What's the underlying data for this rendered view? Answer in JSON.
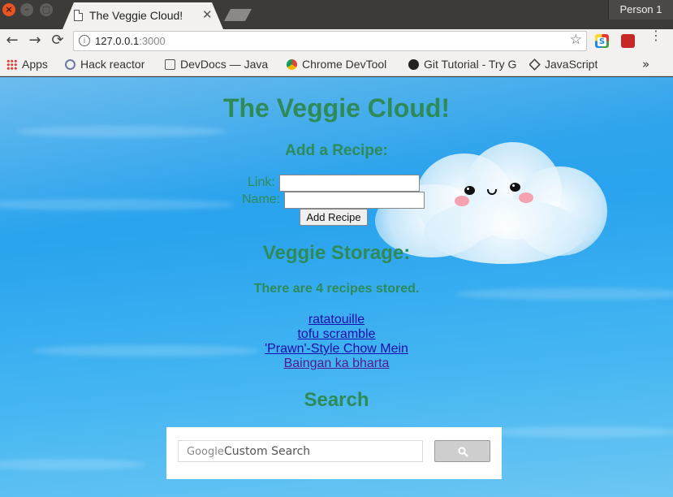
{
  "browser": {
    "tab_title": "The Veggie Cloud!",
    "tab_close": "✕",
    "profile": "Person 1",
    "window_buttons": {
      "close": "×",
      "minimize": "–",
      "maximize": "▢"
    }
  },
  "toolbar": {
    "back": "←",
    "forward": "→",
    "reload": "⟳",
    "info": "i",
    "url_host": "127.0.0.1",
    "url_port": ":3000",
    "star": "☆",
    "menu": "⋮",
    "ext_s": "S"
  },
  "bookmarks": {
    "items": [
      {
        "label": "Apps",
        "icon": "apps-grid-icon"
      },
      {
        "label": "Hack reactor",
        "icon": "hack-reactor-icon"
      },
      {
        "label": "DevDocs — Java",
        "icon": "devdocs-icon"
      },
      {
        "label": "Chrome DevTool",
        "icon": "chrome-icon"
      },
      {
        "label": "Git Tutorial - Try G",
        "icon": "github-icon"
      },
      {
        "label": "JavaScript",
        "icon": "javascript-icon"
      }
    ],
    "overflow": "»"
  },
  "page": {
    "title": "The Veggie Cloud!",
    "add_heading": "Add a Recipe:",
    "link_label": "Link:",
    "name_label": "Name:",
    "link_value": "",
    "name_value": "",
    "add_button": "Add Recipe",
    "storage_heading": "Veggie Storage:",
    "count_text": "There are 4 recipes stored.",
    "recipes": [
      "ratatouille",
      "tofu scramble",
      "'Prawn'-Style Chow Mein",
      "Baingan ka bharta"
    ],
    "search_heading": "Search",
    "search_brand": "Google",
    "search_placeholder": "Custom Search"
  },
  "colors": {
    "heading": "#2e8b57",
    "link": "#1a0dab",
    "visited_link": "#551a8b",
    "sky": "#29a3ee"
  }
}
